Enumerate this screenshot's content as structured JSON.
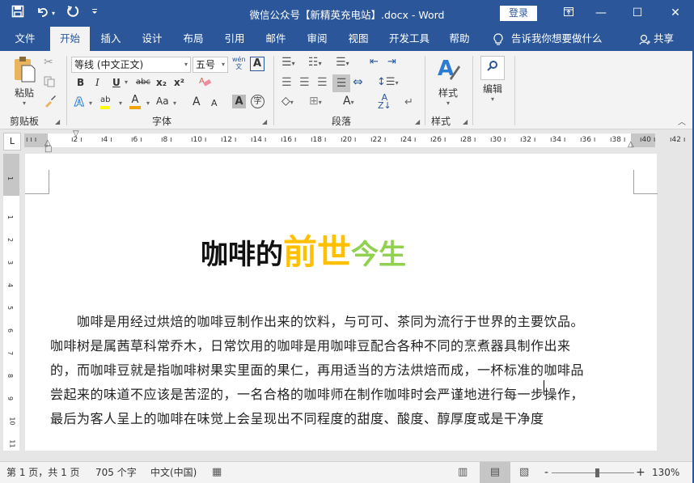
{
  "window": {
    "title": "微信公众号【新精英充电站】.docx  -  Word",
    "login_label": "登录",
    "controls": {
      "ribbon_display": "⊡",
      "minimize": "—",
      "maximize": "☐",
      "close": "✕"
    }
  },
  "qat": {
    "save": "💾",
    "undo": "↶",
    "undo_dropdown": "▾",
    "redo": "↻",
    "customize": "⩡"
  },
  "tabs": [
    {
      "label": "文件",
      "active": false
    },
    {
      "label": "开始",
      "active": true
    },
    {
      "label": "插入",
      "active": false
    },
    {
      "label": "设计",
      "active": false
    },
    {
      "label": "布局",
      "active": false
    },
    {
      "label": "引用",
      "active": false
    },
    {
      "label": "邮件",
      "active": false
    },
    {
      "label": "审阅",
      "active": false
    },
    {
      "label": "视图",
      "active": false
    },
    {
      "label": "开发工具",
      "active": false
    },
    {
      "label": "帮助",
      "active": false
    }
  ],
  "tell_me": {
    "icon": "lightbulb-icon",
    "glyph": "♡",
    "text": "告诉我你想要做什么"
  },
  "share": {
    "icon": "person-icon",
    "glyph": "⚲",
    "label": "共享"
  },
  "ribbon": {
    "clipboard": {
      "paste_label": "粘贴",
      "group_label": "剪贴板"
    },
    "font": {
      "font_name": "等线 (中文正文)",
      "font_size": "五号",
      "buttons": {
        "bold": "B",
        "italic": "I",
        "underline": "U",
        "strike": "abc",
        "subscript": "x₂",
        "superscript": "x²",
        "text_effects": "A",
        "highlight": "ab",
        "font_color": "A",
        "change_case": "Aa",
        "grow": "A",
        "shrink": "A",
        "char_shading": "A",
        "enclose": "字",
        "phonetic": "wén",
        "char_border": "A"
      },
      "group_label": "字体"
    },
    "paragraph": {
      "group_label": "段落"
    },
    "styles": {
      "label": "样式",
      "group_label": "样式"
    },
    "editing": {
      "label": "编辑"
    }
  },
  "ruler": {
    "corner": "L",
    "marks": [
      "2",
      "4",
      "6",
      "8",
      "10",
      "12",
      "14",
      "16",
      "18",
      "20",
      "22",
      "24",
      "26",
      "28",
      "30",
      "32",
      "34",
      "36",
      "38",
      "40",
      "42"
    ],
    "vertical_marks": [
      "1",
      "1",
      "2",
      "3",
      "4",
      "5",
      "6",
      "7",
      "8",
      "9",
      "10",
      "11"
    ]
  },
  "document": {
    "title_parts": [
      "咖啡的",
      "前世",
      "今生"
    ],
    "title_colors": {
      "part1": "#111111",
      "part2": "#ffc000",
      "part3": "#92d050"
    },
    "lines": [
      "　　咖啡是用经过烘焙的咖啡豆制作出来的饮料，与可可、茶同为流行于世界的主要饮品。",
      "咖啡树是属茜草科常乔木，日常饮用的咖啡是用咖啡豆配合各种不同的烹煮器具制作出来",
      "的，而咖啡豆就是指咖啡树果实里面的果仁，再用适当的方法烘焙而成，一杯标准的咖啡品",
      "尝起来的味道不应该是苦涩的，一名合格的咖啡师在制作咖啡时会严谨地进行每一步操作，",
      "最后为客人呈上的咖啡在味觉上会呈现出不同程度的甜度、酸度、醇厚度或是干净度"
    ]
  },
  "status": {
    "page": "第 1 页，共 1 页",
    "words": "705 个字",
    "language": "中文(中国)",
    "zoom": "130%",
    "zoom_minus": "-",
    "zoom_plus": "+"
  },
  "colors": {
    "accent": "#2b579a"
  }
}
